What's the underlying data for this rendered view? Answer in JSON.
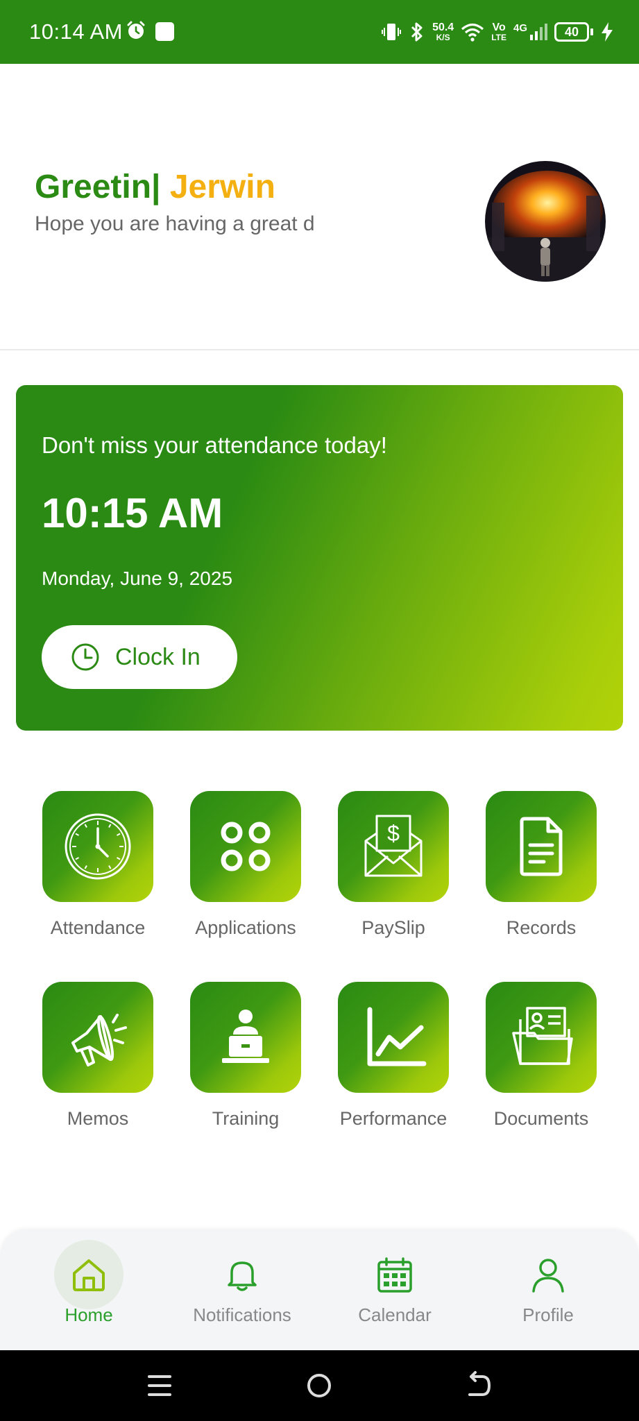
{
  "status_bar": {
    "time": "10:14 AM",
    "speed_value": "50.4",
    "speed_unit": "K/S",
    "volte_top": "Vo",
    "volte_bottom": "LTE",
    "network": "4G",
    "battery": "40",
    "icons": [
      "alarm-icon",
      "square-notification-icon",
      "vibrate-icon",
      "bluetooth-icon",
      "wifi-icon",
      "signal-icon",
      "battery-icon",
      "charging-icon"
    ]
  },
  "greeting": {
    "text": "Greetin|",
    "name": "Jerwin",
    "subtitle": "Hope you are having a great d"
  },
  "attendance_card": {
    "message": "Don't miss your attendance today!",
    "time": "10:15 AM",
    "date": "Monday, June 9, 2025",
    "button_label": "Clock In"
  },
  "menu": [
    {
      "label": "Attendance",
      "icon": "clock-icon"
    },
    {
      "label": "Applications",
      "icon": "apps-icon"
    },
    {
      "label": "PaySlip",
      "icon": "payslip-envelope-icon"
    },
    {
      "label": "Records",
      "icon": "document-icon"
    },
    {
      "label": "Memos",
      "icon": "megaphone-icon"
    },
    {
      "label": "Training",
      "icon": "presenter-laptop-icon"
    },
    {
      "label": "Performance",
      "icon": "line-chart-icon"
    },
    {
      "label": "Documents",
      "icon": "folder-id-icon"
    }
  ],
  "bottom_nav": [
    {
      "label": "Home",
      "icon": "home-icon",
      "active": true
    },
    {
      "label": "Notifications",
      "icon": "bell-icon",
      "active": false
    },
    {
      "label": "Calendar",
      "icon": "calendar-icon",
      "active": false
    },
    {
      "label": "Profile",
      "icon": "person-icon",
      "active": false
    }
  ],
  "colors": {
    "brand_green": "#2a8a13",
    "accent_lime": "#b1d208",
    "accent_yellow": "#f4b010",
    "nav_active": "#2b9f2b"
  }
}
